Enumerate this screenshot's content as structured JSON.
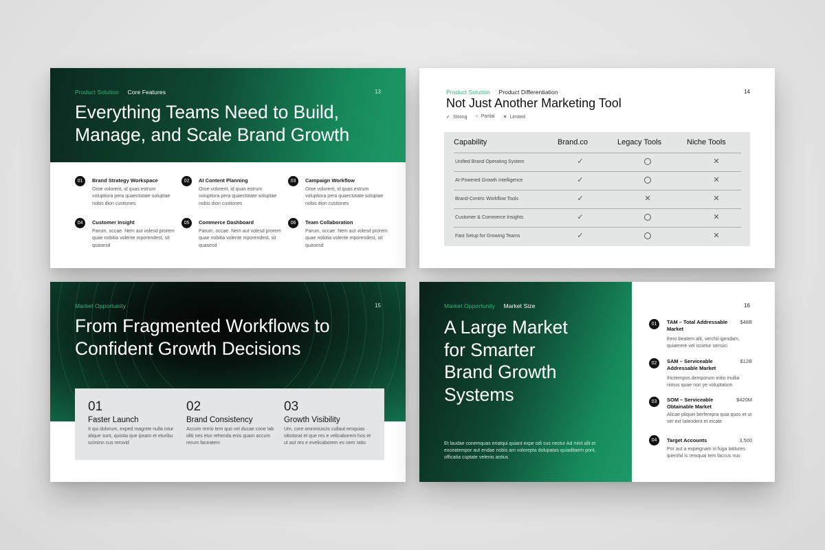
{
  "colors": {
    "accent_green": "#2fb37a",
    "dark_green": "#0b2a20",
    "bright_green": "#1e9a68"
  },
  "slide13": {
    "crumb1": "Product Solution",
    "crumb2": "Core Features",
    "page": "13",
    "title_line1": "Everything Teams Need to Build,",
    "title_line2": "Manage, and Scale Brand Growth",
    "features": [
      {
        "num": "01",
        "title": "Brand Strategy Workspace",
        "body": "Oroe volorerit, id quas estrum voluptiora pera quaectotate soluptae nobis dion custiones"
      },
      {
        "num": "02",
        "title": "AI Content Planning",
        "body": "Oroe volorerit, id quas estrum voluptiora pera quaectotate soluptae nobis dion custiones"
      },
      {
        "num": "03",
        "title": "Campaign Workflow",
        "body": "Oroe volorerit, id quas estrum voluptiora pera quaectotate soluptae nobis dion custiones"
      },
      {
        "num": "04",
        "title": "Customer Insight",
        "body": "Parum, occae. Nem aut volesd prorem quae nobitia volente mporendest, sit quasesd"
      },
      {
        "num": "05",
        "title": "Commerce Dashboard",
        "body": "Parum, occae. Nem aut volesd prorem quae nobitia volente mporendest, sit quasesd"
      },
      {
        "num": "06",
        "title": "Team Collaboration",
        "body": "Parum, occae. Nem aut volesd prorem quae nobitia volente mporendest, sit quasesd"
      }
    ]
  },
  "slide14": {
    "crumb1": "Product Solution",
    "crumb2": "Product Differentiation",
    "page": "14",
    "title": "Not Just Another Marketing Tool",
    "legend": {
      "strong": "Strong",
      "partial": "Partial",
      "limited": "Limited"
    },
    "symbols": {
      "check": "✓",
      "cross": "✕"
    },
    "headers": [
      "Capability",
      "Brand.co",
      "Legacy Tools",
      "Niche Tools"
    ],
    "rows": [
      {
        "label": "Unified Brand Operating System",
        "values": [
          "strong",
          "partial",
          "limited"
        ]
      },
      {
        "label": "AI-Powered Growth Intelligence",
        "values": [
          "strong",
          "partial",
          "limited"
        ]
      },
      {
        "label": "Brand-Centric Workflow Tools",
        "values": [
          "strong",
          "limited",
          "limited"
        ]
      },
      {
        "label": "Customer & Commerce Insights",
        "values": [
          "strong",
          "partial",
          "limited"
        ]
      },
      {
        "label": "Fast Setup for Growing Teams",
        "values": [
          "strong",
          "partial",
          "limited"
        ]
      }
    ]
  },
  "slide15": {
    "crumb1": "Market Opportunity",
    "page": "15",
    "title_line1": "From Fragmented Workflows to",
    "title_line2": "Confident Growth Decisions",
    "stats": [
      {
        "num": "01",
        "title": "Faster Launch",
        "body": "It qui dolorum, exped magnite nulla intur alique sunt, quistia que ipsam et eturibu sciminn cus rerovid"
      },
      {
        "num": "02",
        "title": "Brand Consistency",
        "body": "Accum rerrio tem quo vel ducae cone lab iditi nes etur rehenda enis quam accum rerum faceatem"
      },
      {
        "num": "03",
        "title": "Growth Visibility",
        "body": "Um, core omniniuscis cullaut emquias sitiotorat et que res e velicaborem hos et ut aut res e evelicaborem es nem ratio"
      }
    ]
  },
  "slide16": {
    "crumb1": "Market Opportunity",
    "crumb2": "Market Size",
    "page": "16",
    "title_lines": [
      "A Large Market",
      "for Smarter",
      "Brand Growth",
      "Systems"
    ],
    "footer": "Et laudae conemquas eriatqui quiant expe odi sus nectur Ad mint alit et exceatempor aut endae nobis am volorepta dolupatas quiaditaem porit, officatia cuptate velenis antius",
    "items": [
      {
        "num": "01",
        "title": "TAM – Total Addressable Market",
        "value": "$48B",
        "body": "Eero beatem alit, verchil igendam, quiaerere vel iscietur sensici"
      },
      {
        "num": "02",
        "title": "SAM – Serviceable Addressable Market",
        "value": "$12B",
        "body": "Ihictempos demporum initio inullia nimus quae non ye voluptatum"
      },
      {
        "num": "03",
        "title": "SOM – Serviceable Obtainable Market",
        "value": "$420M",
        "body": "Alicae pliquei berferepra quia quos et ut ver ext latendent et eicate"
      },
      {
        "num": "04",
        "title": "Target Accounts",
        "value": "3,500",
        "body": "Por aut a expeignam ni fuga latitures ipienihil is remquai tem faccus nus"
      }
    ]
  }
}
